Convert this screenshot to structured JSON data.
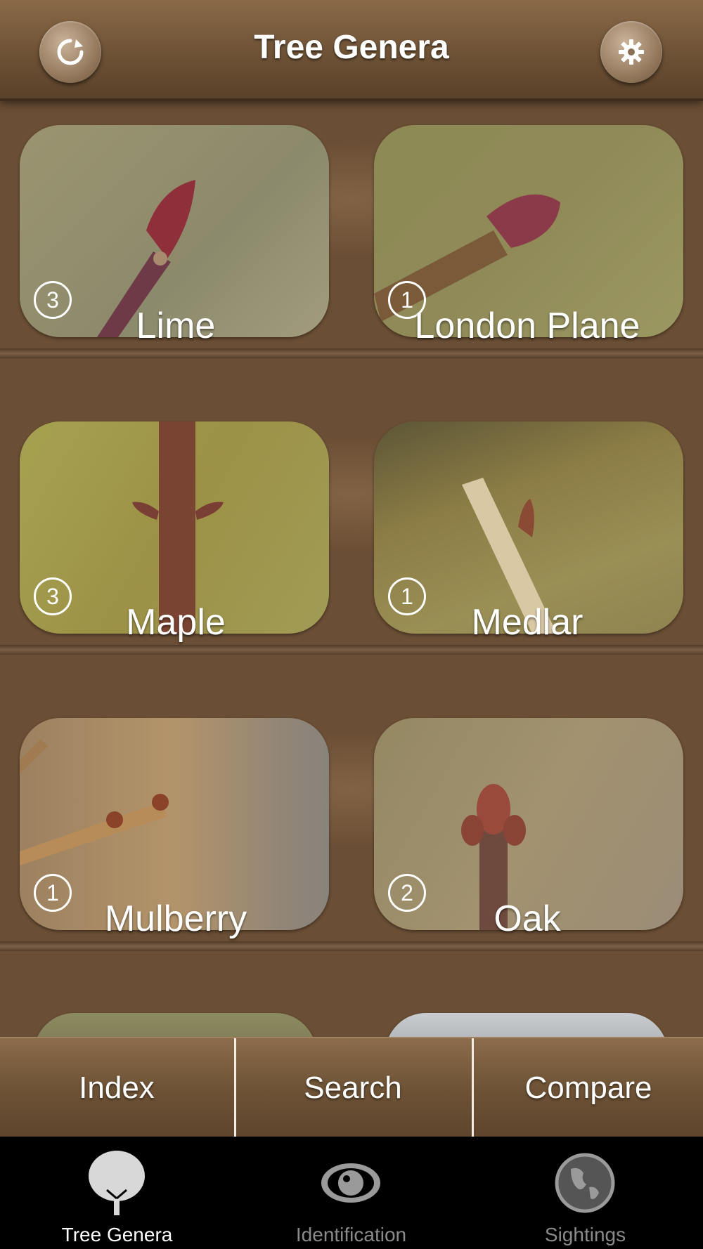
{
  "header": {
    "title": "Tree Genera",
    "refresh_icon": "refresh-icon",
    "settings_icon": "gear-icon"
  },
  "genera": [
    {
      "name": "Lime",
      "count": "3"
    },
    {
      "name": "London Plane",
      "count": "1"
    },
    {
      "name": "Maple",
      "count": "3"
    },
    {
      "name": "Medlar",
      "count": "1"
    },
    {
      "name": "Mulberry",
      "count": "1"
    },
    {
      "name": "Oak",
      "count": "2"
    }
  ],
  "segments": {
    "index": "Index",
    "search": "Search",
    "compare": "Compare"
  },
  "tabs": [
    {
      "label": "Tree Genera",
      "icon": "tree-icon",
      "active": true
    },
    {
      "label": "Identification",
      "icon": "eye-icon",
      "active": false
    },
    {
      "label": "Sightings",
      "icon": "globe-icon",
      "active": false
    }
  ],
  "colors": {
    "background": "#6b4f36",
    "header": "#6e5236",
    "tabbar": "#000000",
    "active_tab_label": "#ffffff",
    "inactive_tab_label": "#8a8a8a"
  }
}
